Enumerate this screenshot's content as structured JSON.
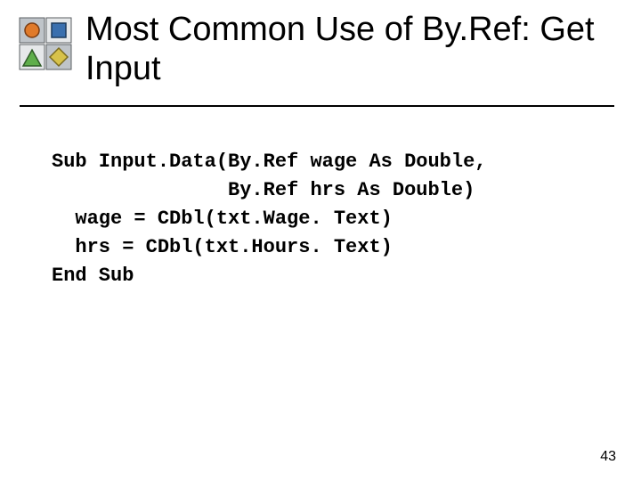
{
  "slide": {
    "title": "Most Common Use of By.Ref: Get Input",
    "page_number": "43"
  },
  "code": {
    "lines": [
      "Sub Input.Data(By.Ref wage As Double,",
      "               By.Ref hrs As Double)",
      "  wage = CDbl(txt.Wage. Text)",
      "  hrs = CDbl(txt.Hours. Text)",
      "End Sub"
    ]
  }
}
